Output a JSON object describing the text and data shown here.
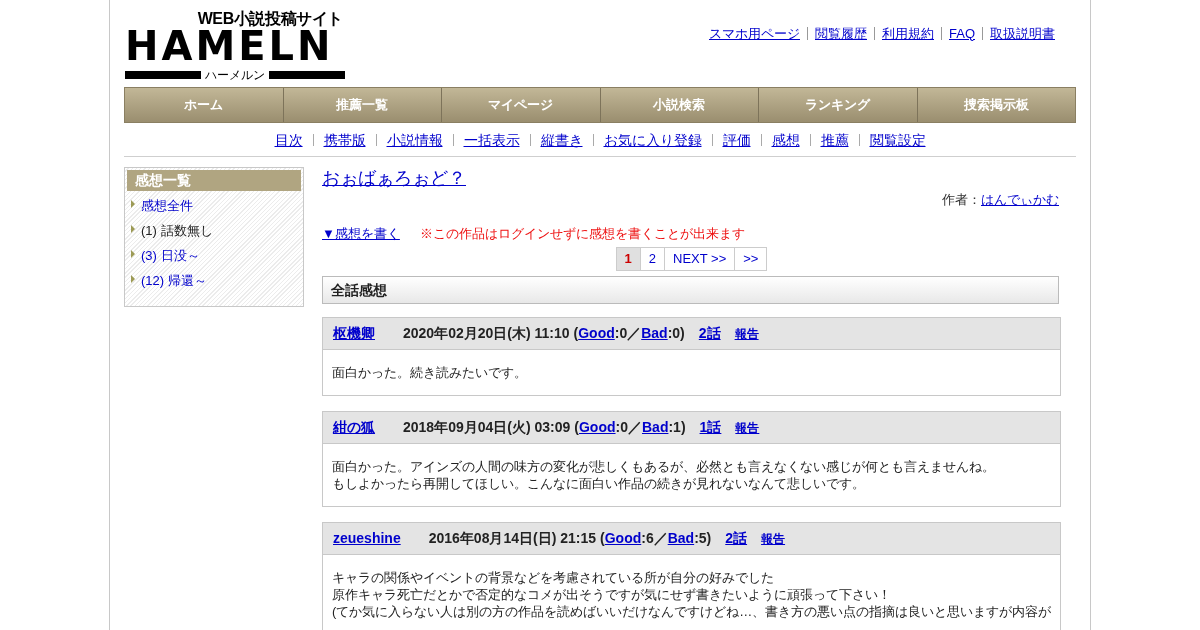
{
  "logo": {
    "tagline": "WEB小説投稿サイト",
    "wordmark": "HAMELN",
    "kana": "ハーメルン"
  },
  "top_links": [
    "スマホ用ページ",
    "閲覧履歴",
    "利用規約",
    "FAQ",
    "取扱説明書"
  ],
  "nav": [
    "ホーム",
    "推薦一覧",
    "マイページ",
    "小説検索",
    "ランキング",
    "捜索掲示板"
  ],
  "sub_nav": [
    "目次",
    "携帯版",
    "小説情報",
    "一括表示",
    "縦書き",
    "お気に入り登録",
    "評価",
    "感想",
    "推薦",
    "閲覧設定"
  ],
  "sidebar": {
    "title": "感想一覧",
    "items": [
      {
        "label": "感想全件",
        "selected": false
      },
      {
        "label": "(1) 話数無し",
        "selected": true
      },
      {
        "label": "(3) 日没～",
        "selected": false
      },
      {
        "label": "(12) 帰還～",
        "selected": false
      }
    ]
  },
  "work_title": "おぉばぁろぉど？",
  "author": {
    "label": "作者：",
    "name": "はんでぃかむ"
  },
  "write_link": "▼感想を書く",
  "notice": "※この作品はログインせずに感想を書くことが出来ます",
  "pagination": [
    {
      "label": "1",
      "selected": true
    },
    {
      "label": "2",
      "selected": false
    },
    {
      "label": "NEXT >>",
      "selected": false
    },
    {
      "label": ">>",
      "selected": false
    }
  ],
  "section_title": "全話感想",
  "comments": [
    {
      "name": "枢機卿",
      "date": "2020年02月20日(木) 11:10",
      "votes": [
        {
          "kind": "text",
          "text": "("
        },
        {
          "kind": "link",
          "text": "Good"
        },
        {
          "kind": "text",
          "text": ":0／"
        },
        {
          "kind": "link",
          "text": "Bad"
        },
        {
          "kind": "text",
          "text": ":0)"
        }
      ],
      "episode": "2話",
      "report": "報告",
      "lines": [
        "面白かった。続き読みたいです。"
      ]
    },
    {
      "name": "紺の狐",
      "date": "2018年09月04日(火) 03:09",
      "votes": [
        {
          "kind": "text",
          "text": "("
        },
        {
          "kind": "link",
          "text": "Good"
        },
        {
          "kind": "text",
          "text": ":0／"
        },
        {
          "kind": "link",
          "text": "Bad"
        },
        {
          "kind": "text",
          "text": ":1)"
        }
      ],
      "episode": "1話",
      "report": "報告",
      "lines": [
        "面白かった。アインズの人間の味方の変化が悲しくもあるが、必然とも言えなくない感じが何とも言えませんね。",
        "もしよかったら再開してほしい。こんなに面白い作品の続きが見れないなんて悲しいです。"
      ]
    },
    {
      "name": "zeueshine",
      "date": "2016年08月14日(日) 21:15",
      "votes": [
        {
          "kind": "text",
          "text": "("
        },
        {
          "kind": "link",
          "text": "Good"
        },
        {
          "kind": "text",
          "text": ":6／"
        },
        {
          "kind": "link",
          "text": "Bad"
        },
        {
          "kind": "text",
          "text": ":5)"
        }
      ],
      "episode": "2話",
      "report": "報告",
      "lines": [
        "キャラの関係やイベントの背景などを考慮されている所が自分の好みでした",
        "原作キャラ死亡だとかで否定的なコメが出そうですが気にせず書きたいように頑張って下さい！",
        "(てか気に入らない人は別の方の作品を読めばいいだけなんですけどね…、書き方の悪い点の指摘は良いと思いますが内容が"
      ]
    }
  ]
}
